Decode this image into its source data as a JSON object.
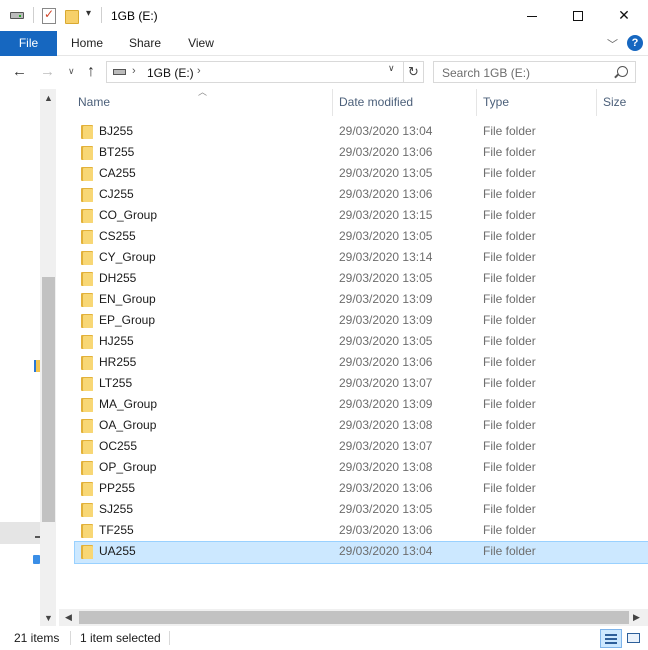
{
  "window": {
    "title": "1GB (E:)",
    "quick_access_dropdown": "▾"
  },
  "ribbon": {
    "tabs": [
      {
        "label": "File"
      },
      {
        "label": "Home"
      },
      {
        "label": "Share"
      },
      {
        "label": "View"
      }
    ]
  },
  "address": {
    "path_label": "1GB (E:)",
    "search_placeholder": "Search 1GB (E:)"
  },
  "columns": {
    "name": "Name",
    "date": "Date modified",
    "type": "Type",
    "size": "Size"
  },
  "files": [
    {
      "name": "BJ255",
      "date": "29/03/2020 13:04",
      "type": "File folder"
    },
    {
      "name": "BT255",
      "date": "29/03/2020 13:06",
      "type": "File folder"
    },
    {
      "name": "CA255",
      "date": "29/03/2020 13:05",
      "type": "File folder"
    },
    {
      "name": "CJ255",
      "date": "29/03/2020 13:06",
      "type": "File folder"
    },
    {
      "name": "CO_Group",
      "date": "29/03/2020 13:15",
      "type": "File folder"
    },
    {
      "name": "CS255",
      "date": "29/03/2020 13:05",
      "type": "File folder"
    },
    {
      "name": "CY_Group",
      "date": "29/03/2020 13:14",
      "type": "File folder"
    },
    {
      "name": "DH255",
      "date": "29/03/2020 13:05",
      "type": "File folder"
    },
    {
      "name": "EN_Group",
      "date": "29/03/2020 13:09",
      "type": "File folder"
    },
    {
      "name": "EP_Group",
      "date": "29/03/2020 13:09",
      "type": "File folder"
    },
    {
      "name": "HJ255",
      "date": "29/03/2020 13:05",
      "type": "File folder"
    },
    {
      "name": "HR255",
      "date": "29/03/2020 13:06",
      "type": "File folder"
    },
    {
      "name": "LT255",
      "date": "29/03/2020 13:07",
      "type": "File folder"
    },
    {
      "name": "MA_Group",
      "date": "29/03/2020 13:09",
      "type": "File folder"
    },
    {
      "name": "OA_Group",
      "date": "29/03/2020 13:08",
      "type": "File folder"
    },
    {
      "name": "OC255",
      "date": "29/03/2020 13:07",
      "type": "File folder"
    },
    {
      "name": "OP_Group",
      "date": "29/03/2020 13:08",
      "type": "File folder"
    },
    {
      "name": "PP255",
      "date": "29/03/2020 13:06",
      "type": "File folder"
    },
    {
      "name": "SJ255",
      "date": "29/03/2020 13:05",
      "type": "File folder"
    },
    {
      "name": "TF255",
      "date": "29/03/2020 13:06",
      "type": "File folder"
    },
    {
      "name": "UA255",
      "date": "29/03/2020 13:04",
      "type": "File folder",
      "selected": true
    }
  ],
  "status": {
    "item_count": "21 items",
    "selection": "1 item selected"
  },
  "colors": {
    "accent": "#1667c0",
    "selection_bg": "#cce8ff",
    "selection_border": "#99d1ff",
    "folder_yellow": "#f8d775"
  }
}
